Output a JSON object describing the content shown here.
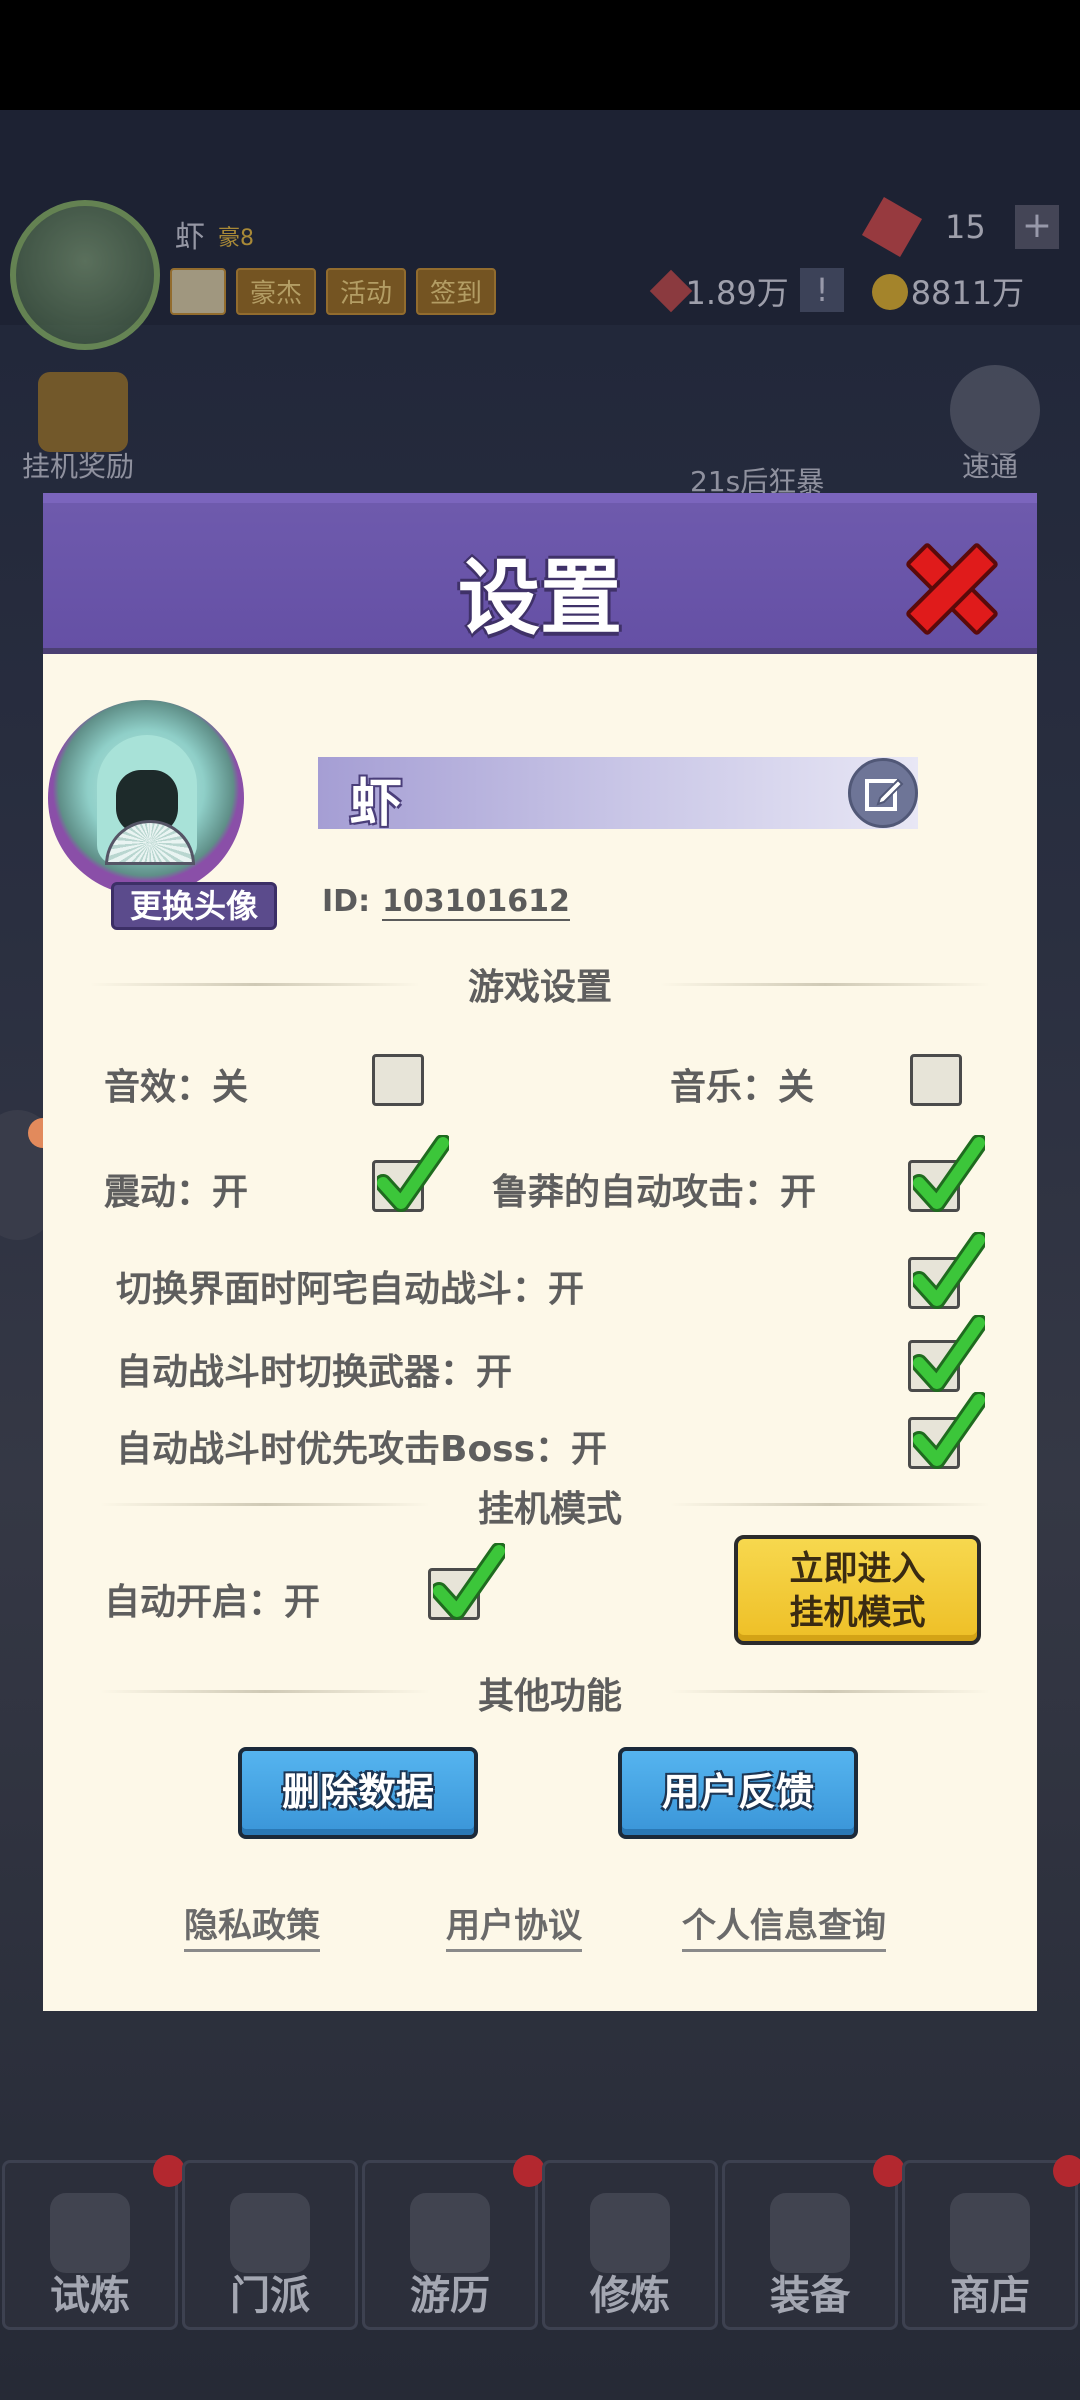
{
  "background": {
    "player_name": "虾",
    "vip": "豪8",
    "tags": [
      "豪杰",
      "活动",
      "签到"
    ],
    "gems": "15",
    "resource1": "1.89万",
    "coins": "8811万",
    "idle_reward_label": "挂机奖励",
    "sweep_label": "速通",
    "timer_text": "21s后狂暴",
    "nav": [
      {
        "label": "试炼",
        "icon": "trial-icon"
      },
      {
        "label": "门派",
        "icon": "sect-icon"
      },
      {
        "label": "游历",
        "icon": "travel-icon"
      },
      {
        "label": "修炼",
        "icon": "cultivate-icon"
      },
      {
        "label": "装备",
        "icon": "equipment-icon"
      },
      {
        "label": "商店",
        "icon": "shop-icon"
      }
    ]
  },
  "dialog": {
    "title": "设置",
    "change_avatar": "更换头像",
    "player_name": "虾",
    "id_label": "ID:",
    "id_value": "103101612",
    "section_game": "游戏设置",
    "section_idle": "挂机模式",
    "section_other": "其他功能",
    "options": {
      "sound": {
        "label": "音效：关",
        "checked": false
      },
      "music": {
        "label": "音乐：关",
        "checked": false
      },
      "vibration": {
        "label": "震动：开",
        "checked": true
      },
      "reckless_auto": {
        "label": "鲁莽的自动攻击：开",
        "checked": true
      },
      "auto_battle_switch": {
        "label": "切换界面时阿宅自动战斗：开",
        "checked": true
      },
      "switch_weapon": {
        "label": "自动战斗时切换武器：开",
        "checked": true
      },
      "boss_first": {
        "label": "自动战斗时优先攻击Boss：开",
        "checked": true
      },
      "auto_idle": {
        "label": "自动开启：开",
        "checked": true
      }
    },
    "enter_idle_line1": "立即进入",
    "enter_idle_line2": "挂机模式",
    "delete_data": "删除数据",
    "feedback": "用户反馈",
    "links": [
      "隐私政策",
      "用户协议",
      "个人信息查询"
    ]
  },
  "colors": {
    "header_purple": "#6e5aad",
    "panel_cream": "#fdf8e8",
    "check_green": "#3cc63a",
    "close_red": "#e01b1b",
    "button_blue": "#3a95d8",
    "button_yellow": "#f7d84e"
  }
}
